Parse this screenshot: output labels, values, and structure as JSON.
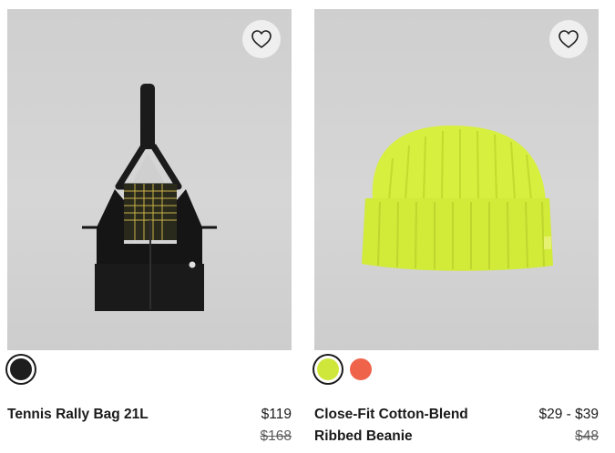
{
  "products": [
    {
      "name": "Tennis Rally Bag 21L",
      "price": "$119",
      "original_price": "$168",
      "swatches": [
        {
          "color": "#1e1e1e",
          "selected": true
        }
      ]
    },
    {
      "name_line1": "Close-Fit Cotton-Blend",
      "name_line2": "Ribbed Beanie",
      "price": "$29 - $39",
      "original_price": "$48",
      "swatches": [
        {
          "color": "#cfe73a",
          "selected": true
        },
        {
          "color": "#f0634b",
          "selected": false
        }
      ]
    }
  ]
}
